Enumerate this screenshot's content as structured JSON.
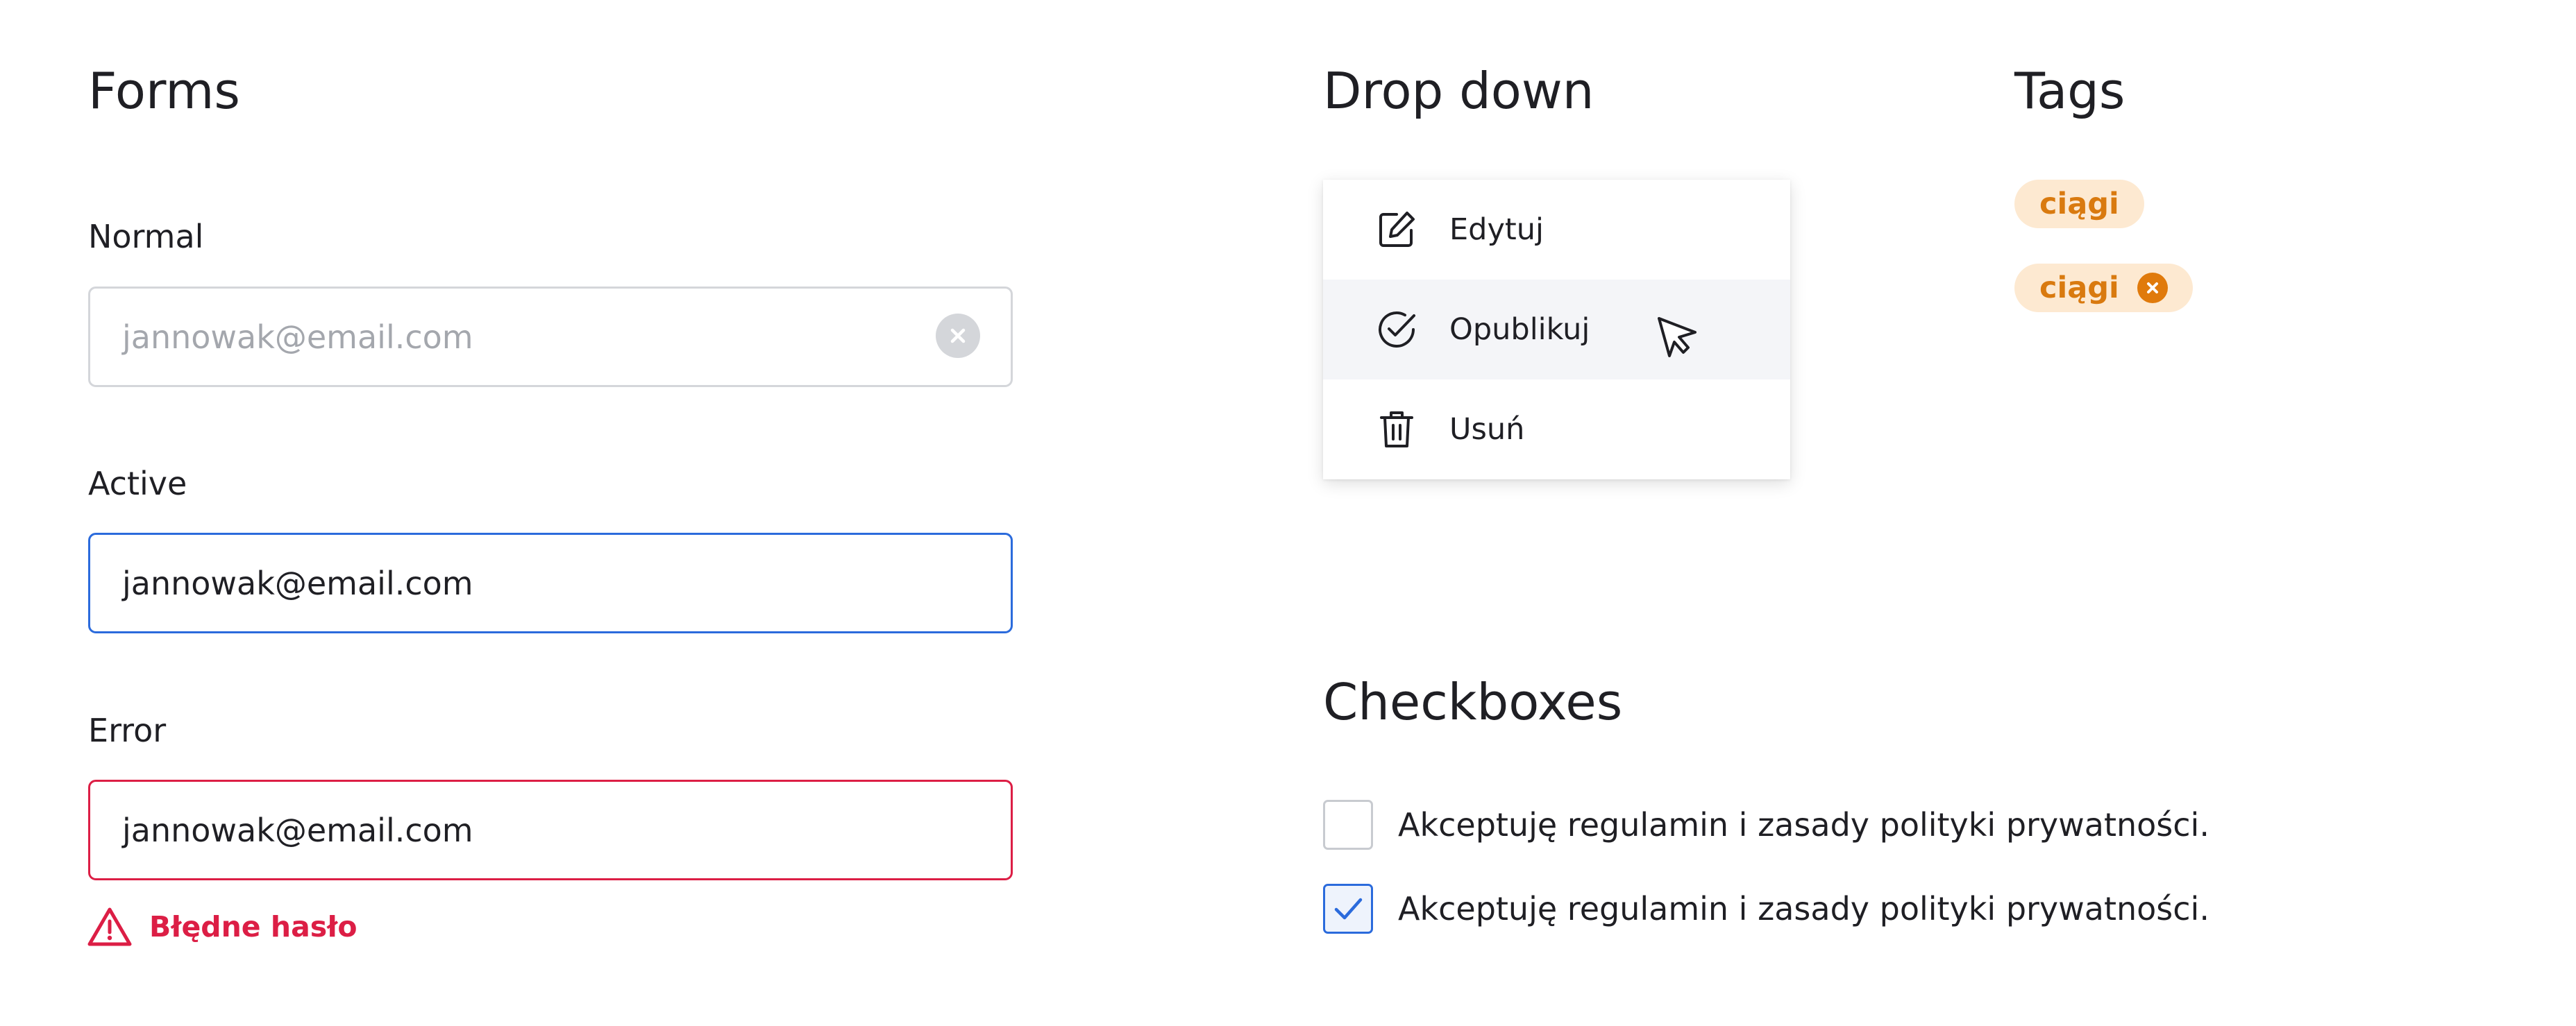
{
  "forms": {
    "title": "Forms",
    "normal": {
      "label": "Normal",
      "placeholder": "jannowak@email.com"
    },
    "active": {
      "label": "Active",
      "value": "jannowak@email.com"
    },
    "error": {
      "label": "Error",
      "value": "jannowak@email.com",
      "message": "Błędne hasło"
    }
  },
  "dropdown": {
    "title": "Drop down",
    "items": [
      {
        "label": "Edytuj",
        "icon": "edit-icon"
      },
      {
        "label": "Opublikuj",
        "icon": "check-circle-icon",
        "hovered": true
      },
      {
        "label": "Usuń",
        "icon": "trash-icon"
      }
    ]
  },
  "tags": {
    "title": "Tags",
    "items": [
      {
        "label": "ciągi",
        "removable": false
      },
      {
        "label": "ciągi",
        "removable": true
      }
    ]
  },
  "checkboxes": {
    "title": "Checkboxes",
    "items": [
      {
        "label": "Akceptuję regulamin i zasady polityki prywatności.",
        "checked": false
      },
      {
        "label": "Akceptuję regulamin i zasady polityki prywatności.",
        "checked": true
      }
    ]
  },
  "colors": {
    "text": "#1f1f24",
    "placeholder": "#a4a7ad",
    "border_normal": "#d4d6da",
    "active": "#2b6bdc",
    "error": "#dc1e45",
    "tag_bg": "#fde9d1",
    "tag_text": "#d97a0f"
  }
}
